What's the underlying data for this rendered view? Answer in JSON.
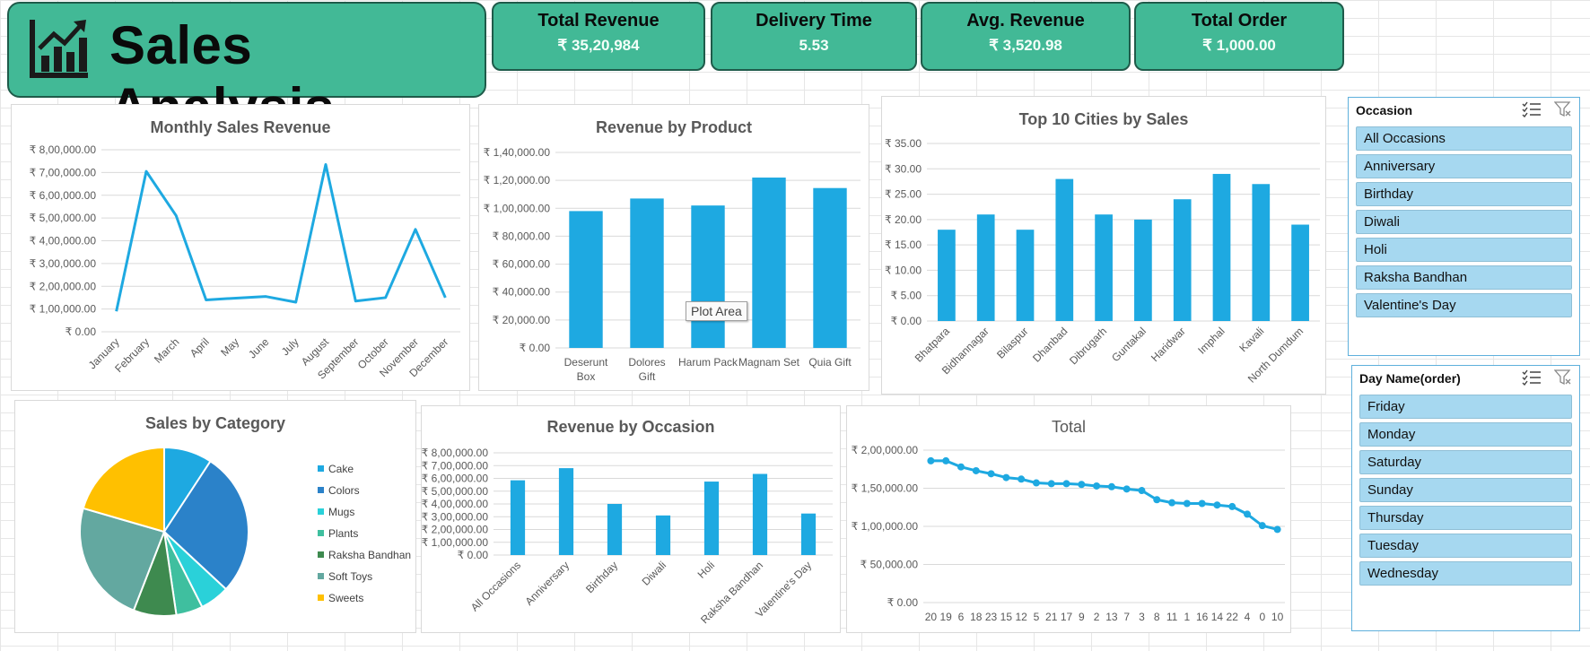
{
  "header": {
    "title": "Sales Analysis",
    "logo_icon": "bar-chart-growth-icon"
  },
  "kpis": [
    {
      "label": "Total Revenue",
      "value": "₹ 35,20,984"
    },
    {
      "label": "Delivery Time",
      "value": "5.53"
    },
    {
      "label": "Avg. Revenue",
      "value": "₹ 3,520.98"
    },
    {
      "label": "Total Order",
      "value": "₹ 1,000.00"
    }
  ],
  "colors": {
    "accent": "#42b996",
    "bar": "#1ea9e1",
    "line": "#1ea9e1",
    "slicer_item": "#a6d8f0"
  },
  "tooltip": "Plot Area",
  "chart_data": [
    {
      "type": "line",
      "title": "Monthly Sales Revenue",
      "categories": [
        "January",
        "February",
        "March",
        "April",
        "May",
        "June",
        "July",
        "August",
        "September",
        "October",
        "November",
        "December"
      ],
      "values": [
        90000,
        705000,
        510000,
        140000,
        148000,
        155000,
        130000,
        735000,
        135000,
        150000,
        450000,
        150000
      ],
      "ylim": [
        0,
        800000
      ],
      "yticks": [
        "₹ 0.00",
        "₹ 1,00,000.00",
        "₹ 2,00,000.00",
        "₹ 3,00,000.00",
        "₹ 4,00,000.00",
        "₹ 5,00,000.00",
        "₹ 6,00,000.00",
        "₹ 7,00,000.00",
        "₹ 8,00,000.00"
      ]
    },
    {
      "type": "bar",
      "title": "Revenue by Product",
      "categories": [
        "Deserunt Box",
        "Dolores Gift",
        "Harum Pack",
        "Magnam Set",
        "Quia Gift"
      ],
      "values": [
        98000,
        107000,
        102000,
        122000,
        114500
      ],
      "ylim": [
        0,
        140000
      ],
      "yticks": [
        "₹ 0.00",
        "₹ 20,000.00",
        "₹ 40,000.00",
        "₹ 60,000.00",
        "₹ 80,000.00",
        "₹ 1,00,000.00",
        "₹ 1,20,000.00",
        "₹ 1,40,000.00"
      ]
    },
    {
      "type": "bar",
      "title": "Top 10 Cities by Sales",
      "categories": [
        "Bhatpara",
        "Bidhannagar",
        "Bilaspur",
        "Dhanbad",
        "Dibrugarh",
        "Guntakal",
        "Haridwar",
        "Imphal",
        "Kavali",
        "North Dumdum"
      ],
      "values": [
        18,
        21,
        18,
        28,
        21,
        20,
        24,
        29,
        27,
        19
      ],
      "ylim": [
        0,
        35
      ],
      "yticks": [
        "₹ 0.00",
        "₹ 5.00",
        "₹ 10.00",
        "₹ 15.00",
        "₹ 20.00",
        "₹ 25.00",
        "₹ 30.00",
        "₹ 35.00"
      ]
    },
    {
      "type": "pie",
      "title": "Sales by Category",
      "categories": [
        "Cake",
        "Colors",
        "Mugs",
        "Plants",
        "Raksha Bandhan",
        "Soft Toys",
        "Sweets"
      ],
      "values": [
        9,
        27,
        5.5,
        5,
        8,
        23,
        20
      ],
      "colors": [
        "#1ea9e1",
        "#2b82c9",
        "#2ad1d9",
        "#3fbf9f",
        "#3e8a4f",
        "#63a8a0",
        "#ffc000"
      ]
    },
    {
      "type": "bar",
      "title": "Revenue by Occasion",
      "categories": [
        "All Occasions",
        "Anniversary",
        "Birthday",
        "Diwali",
        "Holi",
        "Raksha Bandhan",
        "Valentine's Day"
      ],
      "values": [
        585000,
        680000,
        400000,
        310000,
        575000,
        635000,
        325000
      ],
      "ylim": [
        0,
        800000
      ],
      "yticks": [
        "₹ 0.00",
        "₹ 1,00,000.00",
        "₹ 2,00,000.00",
        "₹ 3,00,000.00",
        "₹ 4,00,000.00",
        "₹ 5,00,000.00",
        "₹ 6,00,000.00",
        "₹ 7,00,000.00",
        "₹ 8,00,000.00"
      ]
    },
    {
      "type": "line",
      "title": "Total",
      "categories": [
        "20",
        "19",
        "6",
        "18",
        "23",
        "15",
        "12",
        "5",
        "21",
        "17",
        "9",
        "2",
        "13",
        "7",
        "3",
        "8",
        "11",
        "1",
        "16",
        "14",
        "22",
        "4",
        "0",
        "10"
      ],
      "values": [
        186000,
        186000,
        178000,
        173000,
        169000,
        164000,
        162000,
        157000,
        156000,
        156000,
        155000,
        153000,
        152000,
        149000,
        147000,
        135000,
        131000,
        130000,
        130000,
        128000,
        126000,
        116000,
        101000,
        96000
      ],
      "ylim": [
        0,
        200000
      ],
      "yticks": [
        "₹ 0.00",
        "₹ 50,000.00",
        "₹ 1,00,000.00",
        "₹ 1,50,000.00",
        "₹ 2,00,000.00"
      ]
    }
  ],
  "slicers": {
    "occasion": {
      "title": "Occasion",
      "items": [
        "All Occasions",
        "Anniversary",
        "Birthday",
        "Diwali",
        "Holi",
        "Raksha Bandhan",
        "Valentine's Day"
      ]
    },
    "day": {
      "title": "Day Name(order)",
      "items": [
        "Friday",
        "Monday",
        "Saturday",
        "Sunday",
        "Thursday",
        "Tuesday",
        "Wednesday"
      ]
    }
  }
}
